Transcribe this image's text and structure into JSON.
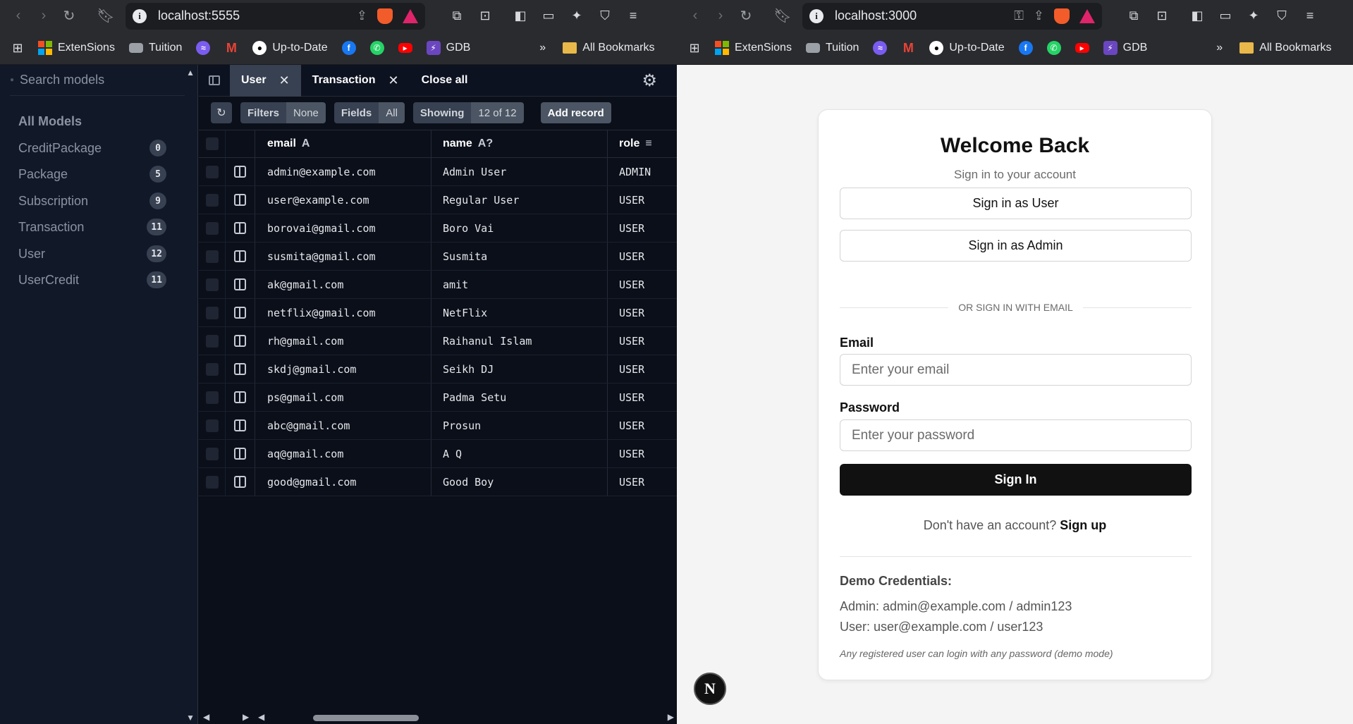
{
  "left_window": {
    "url": "localhost:5555",
    "bookmarks": [
      {
        "label": "ExtenSions",
        "icon": "microsoft-icon"
      },
      {
        "label": "Tuition",
        "icon": "keyboard-icon"
      },
      {
        "label": "",
        "icon": "messenger-icon"
      },
      {
        "label": "",
        "icon": "gmail-icon"
      },
      {
        "label": "Up-to-Date",
        "icon": "github-icon"
      },
      {
        "label": "",
        "icon": "facebook-icon"
      },
      {
        "label": "",
        "icon": "whatsapp-icon"
      },
      {
        "label": "",
        "icon": "youtube-icon"
      },
      {
        "label": "GDB",
        "icon": "bolt-icon"
      }
    ],
    "more_label": "»",
    "all_bookmarks": "All Bookmarks",
    "studio": {
      "search_placeholder": "Search models",
      "all_models_label": "All Models",
      "models": [
        {
          "name": "CreditPackage",
          "count": "0"
        },
        {
          "name": "Package",
          "count": "5"
        },
        {
          "name": "Subscription",
          "count": "9"
        },
        {
          "name": "Transaction",
          "count": "11"
        },
        {
          "name": "User",
          "count": "12"
        },
        {
          "name": "UserCredit",
          "count": "11"
        }
      ],
      "tabs": [
        {
          "label": "User",
          "active": true
        },
        {
          "label": "Transaction",
          "active": false
        }
      ],
      "close_all": "Close all",
      "filters": {
        "key": "Filters",
        "value": "None"
      },
      "fields": {
        "key": "Fields",
        "value": "All"
      },
      "showing": {
        "key": "Showing",
        "value": "12 of 12"
      },
      "add_record": "Add record",
      "columns": [
        {
          "label": "email",
          "type": "A"
        },
        {
          "label": "name",
          "type": "A?"
        },
        {
          "label": "role",
          "type": "≡"
        }
      ],
      "rows": [
        {
          "email": "admin@example.com",
          "name": "Admin User",
          "role": "ADMIN"
        },
        {
          "email": "user@example.com",
          "name": "Regular User",
          "role": "USER"
        },
        {
          "email": "borovai@gmail.com",
          "name": "Boro Vai",
          "role": "USER"
        },
        {
          "email": "susmita@gmail.com",
          "name": "Susmita",
          "role": "USER"
        },
        {
          "email": "ak@gmail.com",
          "name": "amit",
          "role": "USER"
        },
        {
          "email": "netflix@gmail.com",
          "name": "NetFlix",
          "role": "USER"
        },
        {
          "email": "rh@gmail.com",
          "name": "Raihanul Islam",
          "role": "USER"
        },
        {
          "email": "skdj@gmail.com",
          "name": "Seikh DJ",
          "role": "USER"
        },
        {
          "email": "ps@gmail.com",
          "name": "Padma Setu",
          "role": "USER"
        },
        {
          "email": "abc@gmail.com",
          "name": "Prosun",
          "role": "USER"
        },
        {
          "email": "aq@gmail.com",
          "name": "A Q",
          "role": "USER"
        },
        {
          "email": "good@gmail.com",
          "name": "Good Boy",
          "role": "USER"
        }
      ]
    }
  },
  "right_window": {
    "url": "localhost:3000",
    "login": {
      "title": "Welcome Back",
      "subtitle": "Sign in to your account",
      "sign_in_user": "Sign in as User",
      "sign_in_admin": "Sign in as Admin",
      "divider": "OR SIGN IN WITH EMAIL",
      "email_label": "Email",
      "email_placeholder": "Enter your email",
      "password_label": "Password",
      "password_placeholder": "Enter your password",
      "submit": "Sign In",
      "no_account": "Don't have an account?",
      "sign_up": "Sign up",
      "demo_title": "Demo Credentials:",
      "demo_admin": "Admin: admin@example.com / admin123",
      "demo_user": "User: user@example.com / user123",
      "demo_note": "Any registered user can login with any password (demo mode)"
    },
    "next_badge": "N"
  },
  "colors": {
    "studio_bg": "#0b0f19",
    "sidebar_bg": "#111827",
    "chrome_bg": "#2a2b2f",
    "primary_button": "#111111"
  }
}
